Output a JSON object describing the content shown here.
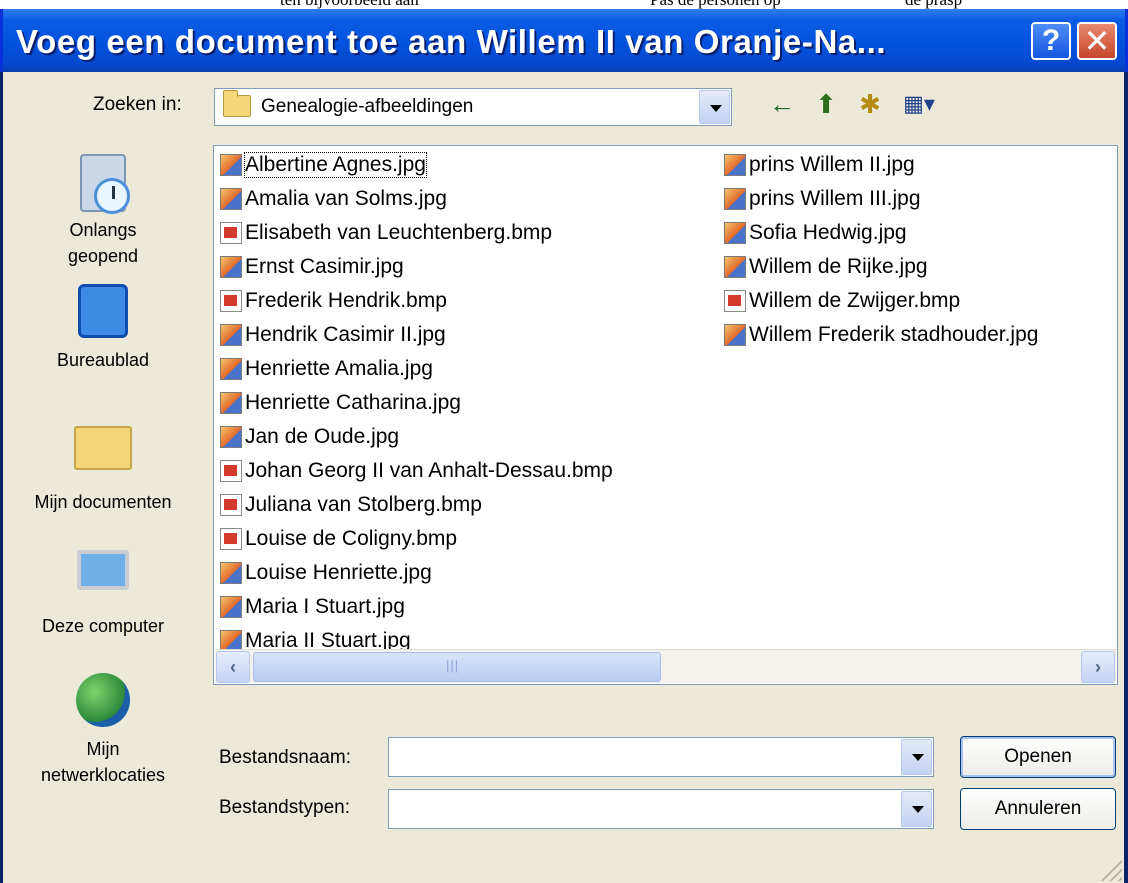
{
  "top_strip": {
    "fragment1": "ten bijvoorbeeld aan",
    "fragment2": "Pas de personen op",
    "fragment3": "de prasp"
  },
  "window": {
    "title": "Voeg een document toe aan Willem II van Oranje-Na...",
    "help_label": "?",
    "close_label": "✕"
  },
  "lookin": {
    "label": "Zoeken in:",
    "value": "Genealogie-afbeeldingen"
  },
  "toolbar": {
    "back_icon": "←",
    "up_icon": "⬆",
    "newfolder_icon": "✱",
    "views_icon": "▦▾"
  },
  "places": [
    {
      "label_line1": "Onlangs",
      "label_line2": "geopend",
      "icon": "recent-icon"
    },
    {
      "label_line1": "Bureaublad",
      "label_line2": "",
      "icon": "desktop-icon"
    },
    {
      "label_line1": "Mijn documenten",
      "label_line2": "",
      "icon": "mydocuments-icon"
    },
    {
      "label_line1": "Deze computer",
      "label_line2": "",
      "icon": "mycomputer-icon"
    },
    {
      "label_line1": "Mijn",
      "label_line2": "netwerklocaties",
      "icon": "network-icon"
    }
  ],
  "files": [
    {
      "name": "Albertine Agnes.jpg",
      "type": "jpg"
    },
    {
      "name": "Amalia van Solms.jpg",
      "type": "jpg"
    },
    {
      "name": "Elisabeth van Leuchtenberg.bmp",
      "type": "bmp"
    },
    {
      "name": "Ernst Casimir.jpg",
      "type": "jpg"
    },
    {
      "name": "Frederik Hendrik.bmp",
      "type": "bmp"
    },
    {
      "name": "Hendrik Casimir II.jpg",
      "type": "jpg"
    },
    {
      "name": "Henriette Amalia.jpg",
      "type": "jpg"
    },
    {
      "name": "Henriette Catharina.jpg",
      "type": "jpg"
    },
    {
      "name": "Jan de Oude.jpg",
      "type": "jpg"
    },
    {
      "name": "Johan Georg II van Anhalt-Dessau.bmp",
      "type": "bmp"
    },
    {
      "name": "Juliana van Stolberg.bmp",
      "type": "bmp"
    },
    {
      "name": "Louise de Coligny.bmp",
      "type": "bmp"
    },
    {
      "name": "Louise Henriette.jpg",
      "type": "jpg"
    },
    {
      "name": "Maria I Stuart.jpg",
      "type": "jpg"
    },
    {
      "name": "Maria II Stuart.jpg",
      "type": "jpg"
    },
    {
      "name": "prins Willem II.jpg",
      "type": "jpg"
    },
    {
      "name": "prins Willem III.jpg",
      "type": "jpg"
    },
    {
      "name": "Sofia Hedwig.jpg",
      "type": "jpg"
    },
    {
      "name": "Willem de Rijke.jpg",
      "type": "jpg"
    },
    {
      "name": "Willem de Zwijger.bmp",
      "type": "bmp"
    },
    {
      "name": "Willem Frederik stadhouder.jpg",
      "type": "jpg"
    }
  ],
  "filename": {
    "label": "Bestandsnaam:",
    "value": ""
  },
  "filetype": {
    "label": "Bestandstypen:",
    "value": ""
  },
  "buttons": {
    "open": "Openen",
    "cancel": "Annuleren"
  }
}
